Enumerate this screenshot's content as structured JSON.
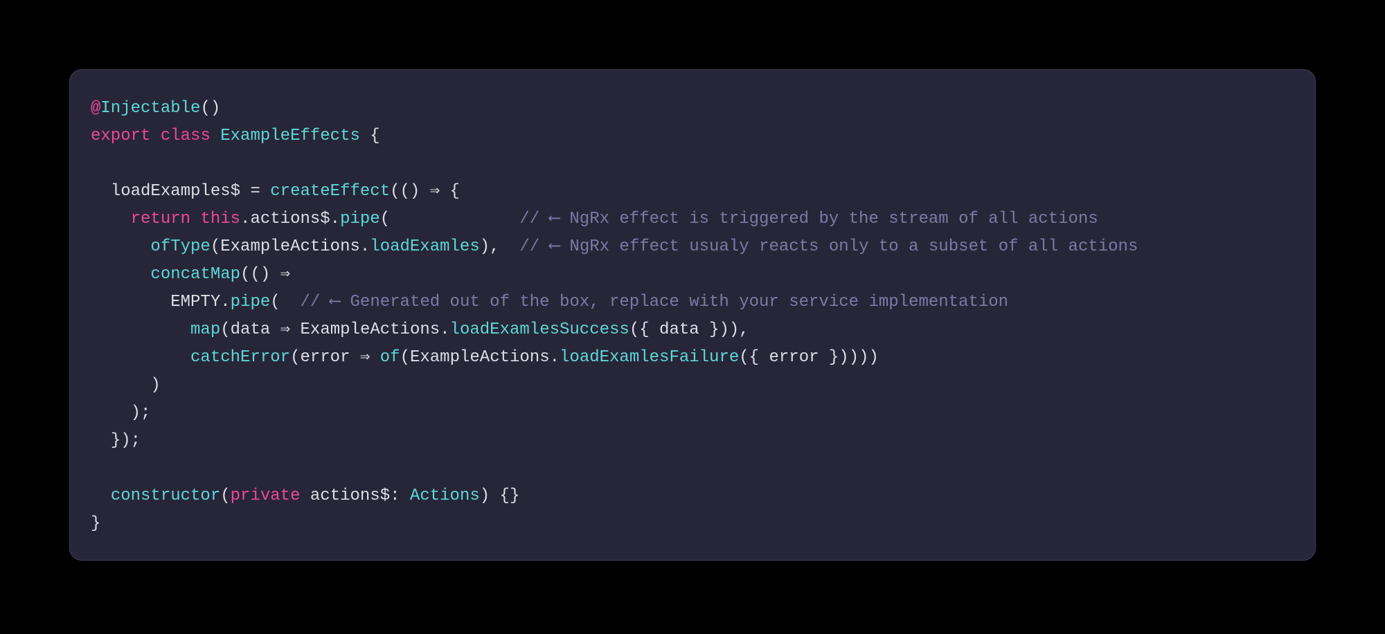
{
  "code": {
    "line1": {
      "at": "@",
      "decorator": "Injectable",
      "paren": "()"
    },
    "line2": {
      "export": "export",
      "class": "class",
      "name": "ExampleEffects",
      "brace": " {"
    },
    "line3": "",
    "line4": {
      "indent": "  ",
      "prop": "loadExamples$",
      "eq": " = ",
      "fn": "createEffect",
      "rest": "(() ⇒ {"
    },
    "line5": {
      "indent": "    ",
      "return": "return",
      "sp": " ",
      "this": "this",
      "dot": ".",
      "actions": "actions$",
      "dot2": ".",
      "pipe": "pipe",
      "open": "(",
      "gap": "             ",
      "comment": "// ⟵ NgRx effect is triggered by the stream of all actions"
    },
    "line6": {
      "indent": "      ",
      "ofType": "ofType",
      "open": "(",
      "ns": "ExampleActions",
      "dot": ".",
      "loadExamles": "loadExamles",
      "close": "),",
      "gap": "  ",
      "comment": "// ⟵ NgRx effect usualy reacts only to a subset of all actions"
    },
    "line7": {
      "indent": "      ",
      "concatMap": "concatMap",
      "rest": "(() ⇒"
    },
    "line8": {
      "indent": "        ",
      "empty": "EMPTY",
      "dot": ".",
      "pipe": "pipe",
      "open": "(",
      "gap": "  ",
      "comment": "// ⟵ Generated out of the box, replace with your service implementation"
    },
    "line9": {
      "indent": "          ",
      "map": "map",
      "open": "(",
      "data": "data",
      "arrow": " ⇒ ",
      "ns": "ExampleActions",
      "dot": ".",
      "success": "loadExamlesSuccess",
      "args": "({ ",
      "data2": "data",
      "close": " })),"
    },
    "line10": {
      "indent": "          ",
      "catchError": "catchError",
      "open": "(",
      "error": "error",
      "arrow": " ⇒ ",
      "of": "of",
      "open2": "(",
      "ns": "ExampleActions",
      "dot": ".",
      "failure": "loadExamlesFailure",
      "args": "({ ",
      "error2": "error",
      "close": " })))) "
    },
    "line11": {
      "indent": "      ",
      "close": ")"
    },
    "line12": {
      "indent": "    ",
      "close": ");"
    },
    "line13": {
      "indent": "  ",
      "close": "});"
    },
    "line14": "",
    "line15": {
      "indent": "  ",
      "constructor": "constructor",
      "open": "(",
      "private": "private",
      "sp": " ",
      "actions": "actions$",
      "colon": ": ",
      "type": "Actions",
      "close": ") {}"
    },
    "line16": {
      "close": "}"
    }
  }
}
